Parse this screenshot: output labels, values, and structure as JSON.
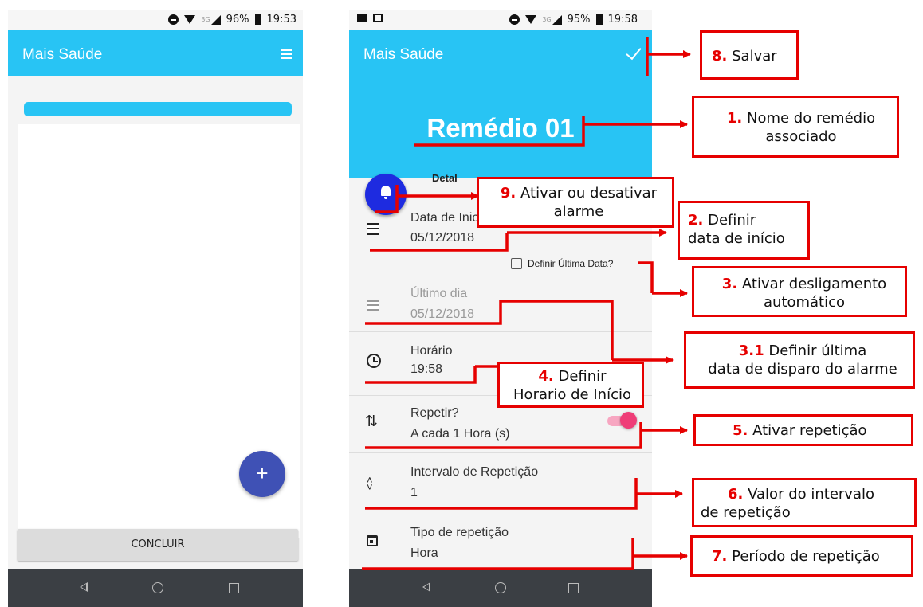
{
  "screen_left": {
    "status": {
      "battery": "96%",
      "time": "19:53"
    },
    "appbar": {
      "title": "Mais Saúde",
      "menu_icon": "list-icon"
    },
    "fab_label": "+",
    "finish_button": "CONCLUIR"
  },
  "screen_right": {
    "status": {
      "battery": "95%",
      "time": "19:58"
    },
    "appbar": {
      "title": "Mais Saúde",
      "action_icon": "check-icon"
    },
    "medicine_name": "Remédio 01",
    "section_label": "Detal",
    "fields": {
      "start_date": {
        "label": "Data de Inicio",
        "value": "05/12/2018"
      },
      "set_last_date": "Definir Última Data?",
      "last_day": {
        "label": "Último dia",
        "value": "05/12/2018"
      },
      "time": {
        "label": "Horário",
        "value": "19:58"
      },
      "repeat": {
        "label": "Repetir?",
        "value": "A cada 1 Hora (s)",
        "enabled": true
      },
      "interval": {
        "label": "Intervalo de Repetição",
        "value": "1"
      },
      "repeat_type": {
        "label": "Tipo de repetição",
        "value": "Hora"
      }
    }
  },
  "annotations": {
    "a8": {
      "num": "8.",
      "text": "Salvar"
    },
    "a1": {
      "num": "1.",
      "text1": "Nome do remédio",
      "text2": "associado"
    },
    "a9": {
      "num": "9.",
      "text1": "Ativar ou desativar",
      "text2": "alarme"
    },
    "a2": {
      "num": "2.",
      "text1": "Definir",
      "text2": "data de início"
    },
    "a3": {
      "num": "3.",
      "text1": "Ativar desligamento",
      "text2": "automático"
    },
    "a31": {
      "num": "3.1",
      "text1": "Definir última",
      "text2": "data de disparo do alarme"
    },
    "a4": {
      "num": "4.",
      "text1": "Definir",
      "text2": "Horario de Início"
    },
    "a5": {
      "num": "5.",
      "text": "Ativar repetição"
    },
    "a6": {
      "num": "6.",
      "text1": "Valor do intervalo",
      "text2": "de repetição"
    },
    "a7": {
      "num": "7.",
      "text": "Período de repetição"
    }
  },
  "colors": {
    "primary": "#28c4f4",
    "fab_add": "#3f51b5",
    "fab_bell": "#1e2be0",
    "accent_toggle": "#ef3d78",
    "annotation": "#e60000"
  }
}
